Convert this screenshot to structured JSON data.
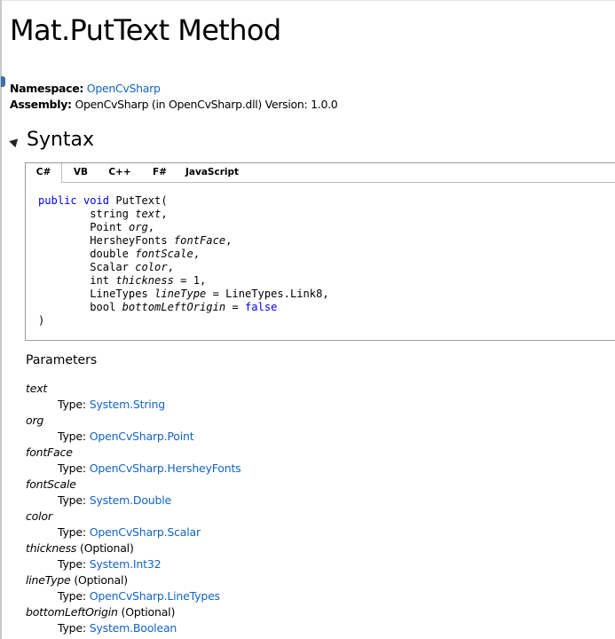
{
  "title": "Mat.PutText Method",
  "meta": {
    "namespace_label": "Namespace:",
    "namespace_value": "OpenCvSharp",
    "assembly_label": "Assembly:",
    "assembly_value": "OpenCvSharp (in OpenCvSharp.dll) Version: 1.0.0"
  },
  "syntax": {
    "heading": "Syntax",
    "tabs": [
      "C#",
      "VB",
      "C++",
      "F#",
      "JavaScript"
    ],
    "active_tab": "C#",
    "code": {
      "kw_public": "public",
      "kw_void": "void",
      "method_open": "PutText(",
      "params": [
        {
          "type": "string",
          "name": "text",
          "suffix": ","
        },
        {
          "type": "Point",
          "name": "org",
          "suffix": ","
        },
        {
          "type": "HersheyFonts",
          "name": "fontFace",
          "suffix": ","
        },
        {
          "type": "double",
          "name": "fontScale",
          "suffix": ","
        },
        {
          "type": "Scalar",
          "name": "color",
          "suffix": ","
        },
        {
          "type": "int",
          "name": "thickness",
          "suffix": " = 1,"
        },
        {
          "type": "LineTypes",
          "name": "lineType",
          "suffix": " = LineTypes.Link8,"
        },
        {
          "type": "bool",
          "name": "bottomLeftOrigin",
          "suffix": " = ",
          "kw_value": "false"
        }
      ],
      "close": ")"
    }
  },
  "parameters": {
    "heading": "Parameters",
    "type_label": "Type:",
    "items": [
      {
        "name": "text",
        "optional": "",
        "type": "System.String"
      },
      {
        "name": "org",
        "optional": "",
        "type": "OpenCvSharp.Point"
      },
      {
        "name": "fontFace",
        "optional": "",
        "type": "OpenCvSharp.HersheyFonts"
      },
      {
        "name": "fontScale",
        "optional": "",
        "type": "System.Double"
      },
      {
        "name": "color",
        "optional": "",
        "type": "OpenCvSharp.Scalar"
      },
      {
        "name": "thickness",
        "optional": "(Optional)",
        "type": "System.Int32"
      },
      {
        "name": "lineType",
        "optional": "(Optional)",
        "type": "OpenCvSharp.LineTypes"
      },
      {
        "name": "bottomLeftOrigin",
        "optional": "(Optional)",
        "type": "System.Boolean"
      }
    ]
  },
  "colors": {
    "link": "#1364c4",
    "keyword": "#0000ff"
  }
}
